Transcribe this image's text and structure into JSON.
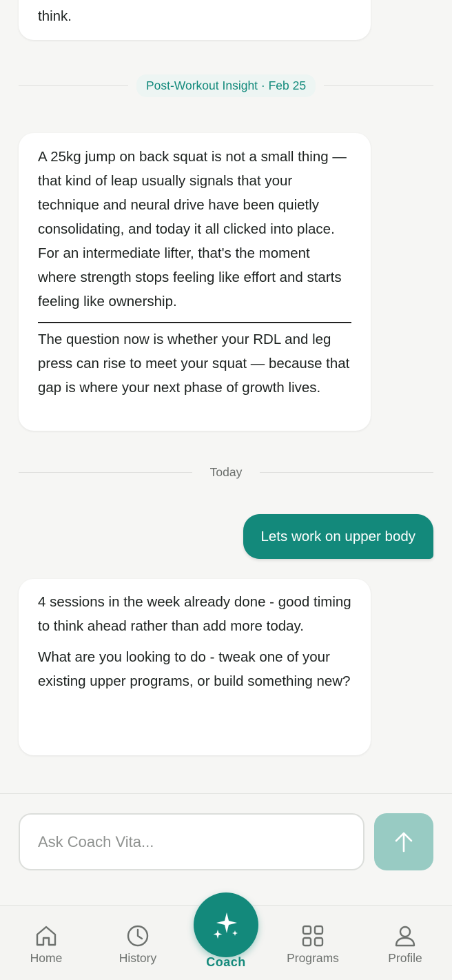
{
  "messages": {
    "top_fragment": "think.",
    "insight_divider": "Post-Workout Insight · Feb 25",
    "insight_para1": "A 25kg jump on back squat is not a small thing — that kind of leap usually signals that your technique and neural drive have been quietly consolidating, and today it all clicked into place. For an intermediate lifter, that's the moment where strength stops feeling like effort and starts feeling like ownership.",
    "insight_para2": "The question now is whether your RDL and leg press can rise to meet your squat — because that gap is where your next phase of growth lives.",
    "today_divider": "Today",
    "user_message": "Lets work on upper body",
    "reply_para1": "4 sessions in the week already done - good timing to think ahead rather than add more today.",
    "reply_para2": "What are you looking to do - tweak one of your existing upper programs, or build something new?"
  },
  "composer": {
    "placeholder": "Ask Coach Vita...",
    "send_icon": "arrow-up-icon"
  },
  "tabs": [
    {
      "label": "Home",
      "icon": "home-icon"
    },
    {
      "label": "History",
      "icon": "clock-icon"
    },
    {
      "label": "Coach",
      "icon": "sparkles-icon"
    },
    {
      "label": "Programs",
      "icon": "grid-icon"
    },
    {
      "label": "Profile",
      "icon": "user-icon"
    }
  ],
  "colors": {
    "accent": "#13897b",
    "send_disabled": "#98cbc3",
    "background": "#f6f6f4"
  }
}
